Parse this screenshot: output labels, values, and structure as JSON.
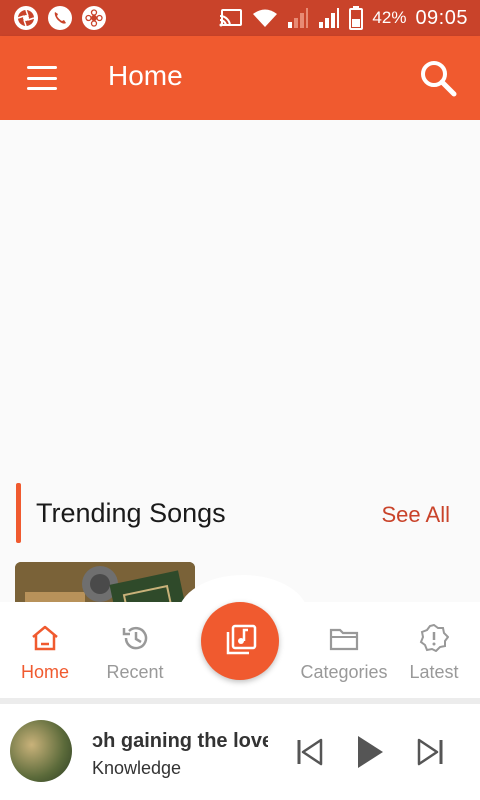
{
  "status_bar": {
    "battery_percent": "42%",
    "time": "09:05",
    "icons": [
      "camera-aperture-icon",
      "phone-icon",
      "flower-icon",
      "cast-icon",
      "wifi-icon",
      "signal-weak-icon",
      "signal-strong-icon",
      "battery-icon"
    ]
  },
  "app_bar": {
    "title": "Home",
    "menu_icon": "hamburger-menu-icon",
    "search_icon": "search-icon"
  },
  "trending": {
    "title": "Trending Songs",
    "see_all": "See All"
  },
  "bottom_nav": {
    "items": [
      {
        "label": "Home",
        "icon": "home-icon",
        "active": true
      },
      {
        "label": "Recent",
        "icon": "history-icon",
        "active": false
      },
      {
        "label": "Categories",
        "icon": "folder-icon",
        "active": false
      },
      {
        "label": "Latest",
        "icon": "alert-gear-icon",
        "active": false
      }
    ],
    "center_icon": "music-library-icon"
  },
  "mini_player": {
    "title": "ɔh gaining the love",
    "subtitle": "Knowledge",
    "controls": [
      "skip-previous-icon",
      "play-icon",
      "skip-next-icon"
    ]
  },
  "colors": {
    "status_bar": "#c9432a",
    "accent": "#f05a2f",
    "see_all": "#c9432a",
    "inactive": "#999999"
  }
}
